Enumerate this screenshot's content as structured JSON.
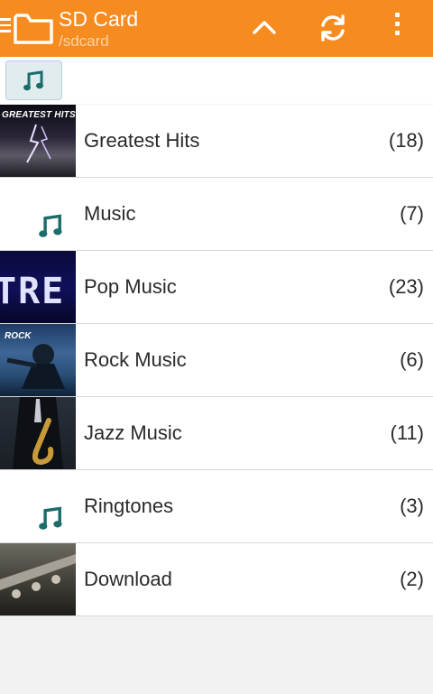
{
  "appbar": {
    "title": "SD Card",
    "path": "/sdcard",
    "icons": [
      "menu-icon",
      "folder-icon",
      "up-arrow-icon",
      "refresh-icon",
      "more-options-icon"
    ],
    "colors": {
      "background": "#f68b1f",
      "title": "#ffffff",
      "path": "#fcd2a4"
    }
  },
  "filter": {
    "icon": "music-note-icon",
    "selected": true
  },
  "folders": [
    {
      "name": "Greatest Hits",
      "count": "(18)",
      "thumb": "album-art",
      "art_text": "GREATEST HITS"
    },
    {
      "name": "Music",
      "count": "(7)",
      "thumb": "music-note-icon"
    },
    {
      "name": "Pop Music",
      "count": "(23)",
      "thumb": "album-art",
      "art_text": "TRE"
    },
    {
      "name": "Rock Music",
      "count": "(6)",
      "thumb": "album-art",
      "art_text": "ROCK"
    },
    {
      "name": "Jazz Music",
      "count": "(11)",
      "thumb": "album-art"
    },
    {
      "name": "Ringtones",
      "count": "(3)",
      "thumb": "music-note-icon"
    },
    {
      "name": "Download",
      "count": "(2)",
      "thumb": "album-art"
    }
  ]
}
